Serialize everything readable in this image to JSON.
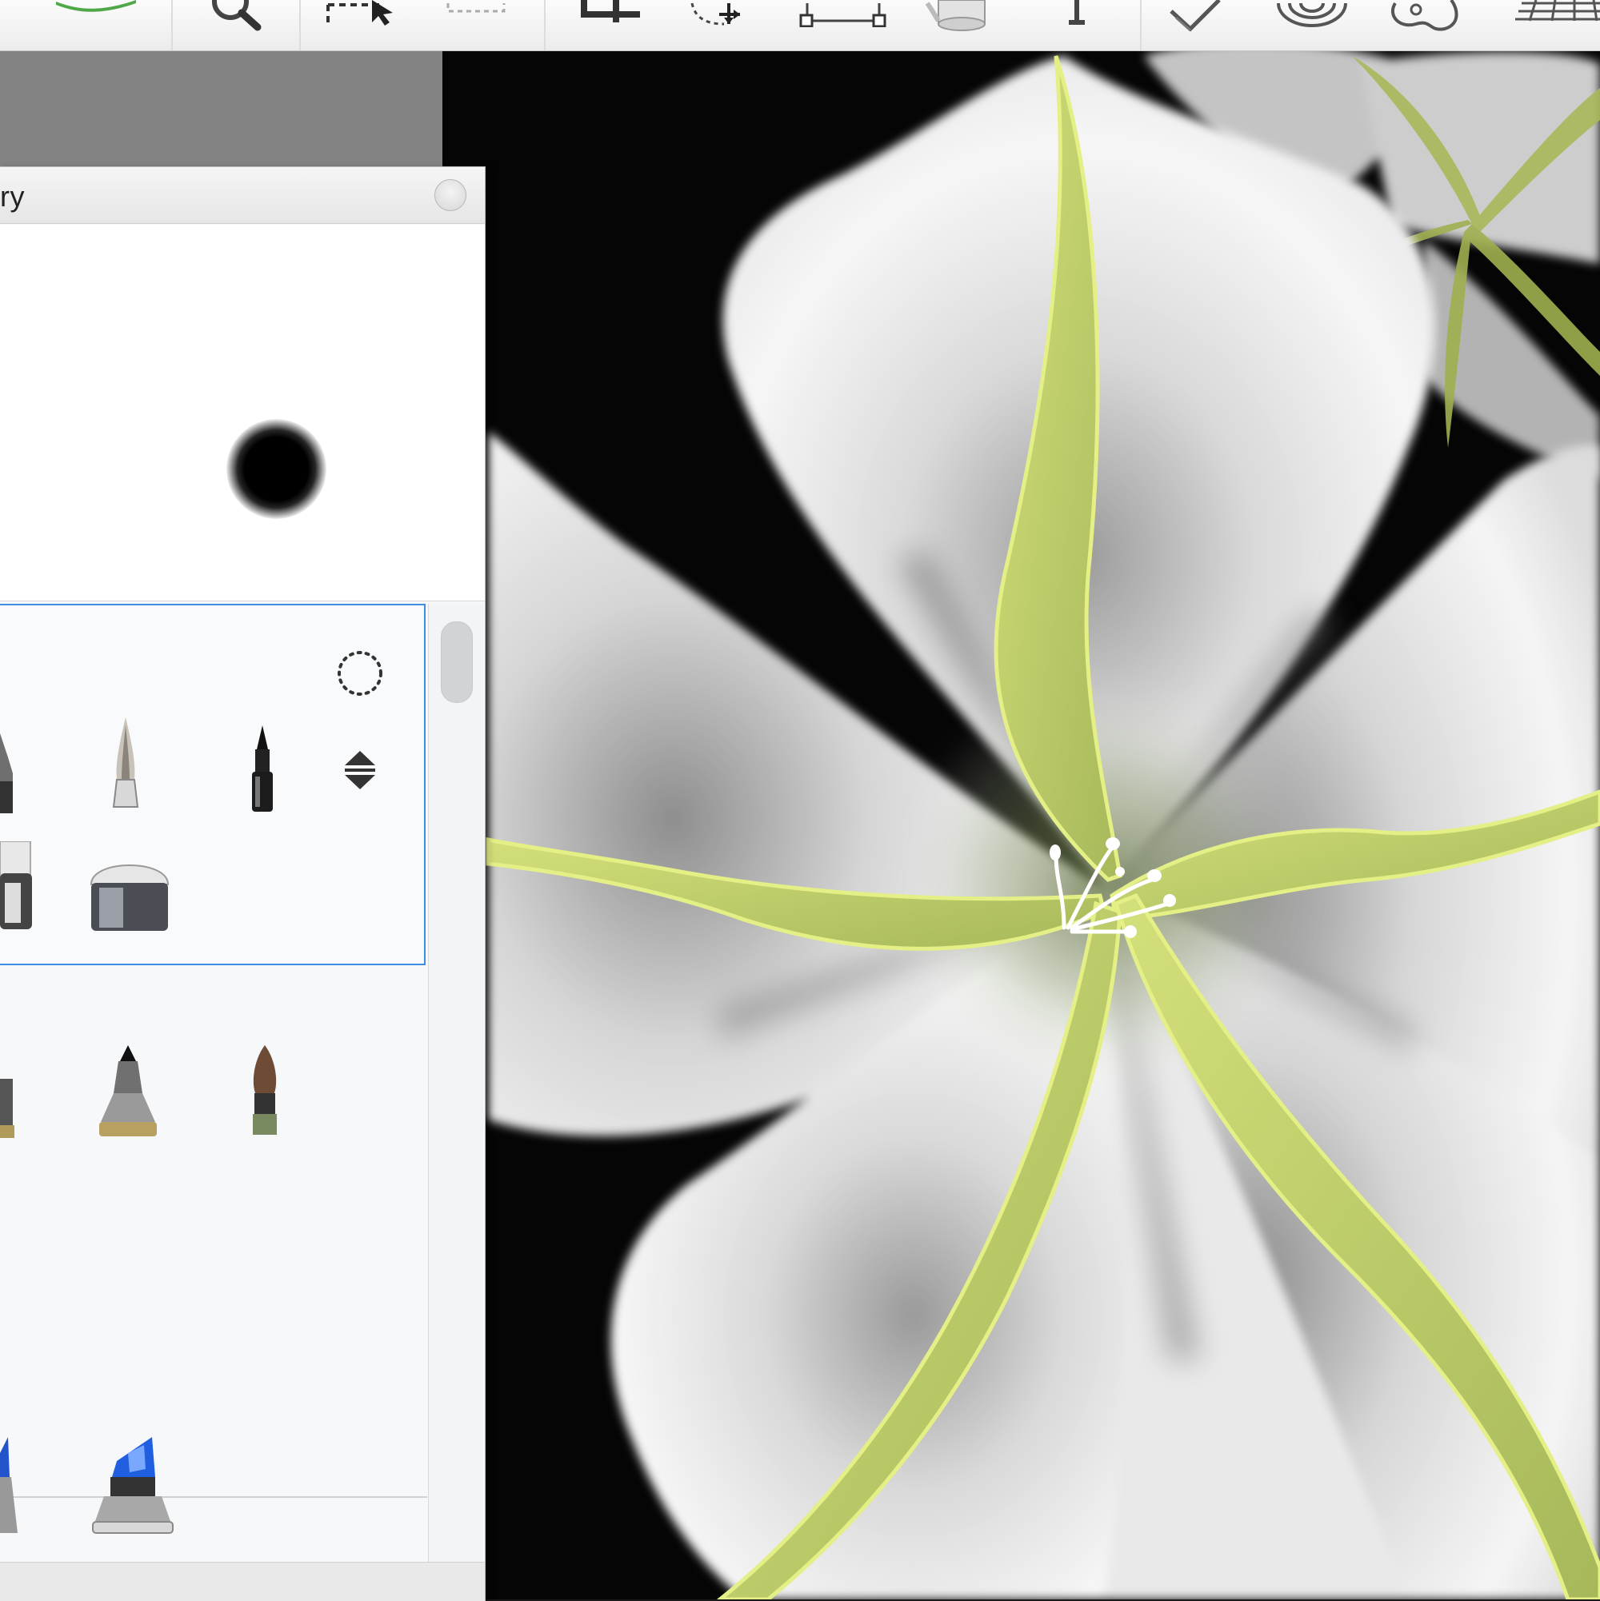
{
  "toolbar": {
    "tools": [
      "brush-tool",
      "zoom-tool",
      "select-tool",
      "lasso-select-tool",
      "crop-tool",
      "transform-tool",
      "distort-tool",
      "ruler-tool",
      "text-tool",
      "stroke-tool",
      "symmetry-tool",
      "french-curve-tool",
      "perspective-grid-tool"
    ]
  },
  "panel": {
    "title": "ry",
    "sets": [
      {
        "name": "set-1",
        "brushes": [
          "marker-brush",
          "paint-brush-fine",
          "technical-pen",
          "wide-marker",
          "eraser-block"
        ],
        "selected": true
      },
      {
        "name": "set-2",
        "brushes": [
          "airbrush",
          "pencil-brush",
          "round-brush"
        ],
        "selected": false
      },
      {
        "name": "set-3",
        "brushes": [
          "chisel-marker",
          "blue-marker"
        ],
        "selected": false
      }
    ]
  },
  "colors": {
    "accent": "#3d8ee0",
    "petal": "#f4f4f4",
    "vein": "#c2d15a",
    "background": "#050505"
  }
}
